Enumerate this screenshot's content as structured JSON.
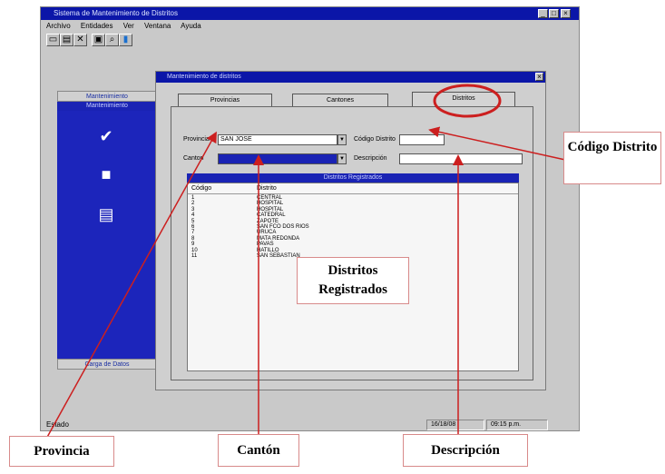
{
  "app": {
    "title": "Sistema de Mantenimiento de Distritos",
    "menu": [
      "Archivo",
      "Entidades",
      "Ver",
      "Ventana",
      "Ayuda"
    ],
    "toolbar_icons": [
      "new-doc-icon",
      "open-icon",
      "delete-icon",
      "save-icon",
      "find-icon",
      "exit-icon"
    ],
    "left_panel": {
      "header1": "Mantenimiento",
      "header2": "Mantenimiento",
      "footer": "Carga de Datos"
    },
    "status": {
      "label": "Estado",
      "date": "16/18/08",
      "time": "09:15 p.m."
    }
  },
  "inner": {
    "title": "Mantenimiento de distritos",
    "tabs": [
      "Provincias",
      "Cantones",
      "Distritos"
    ],
    "form": {
      "provincia_label": "Provincia",
      "provincia_value": "SAN JOSE",
      "canton_label": "Canton",
      "canton_value": "",
      "codigo_label": "Código Distrito",
      "codigo_value": "",
      "descripcion_label": "Descripción",
      "descripcion_value": ""
    },
    "list": {
      "header": "Distritos Registrados",
      "columns": [
        "Código",
        "Distrito"
      ],
      "rows": [
        [
          "1",
          "CENTRAL"
        ],
        [
          "2",
          "HOSPITAL"
        ],
        [
          "3",
          "HOSPITAL"
        ],
        [
          "4",
          "CATEDRAL"
        ],
        [
          "5",
          "ZAPOTE"
        ],
        [
          "6",
          "SAN FCO DOS RIOS"
        ],
        [
          "7",
          "URUCA"
        ],
        [
          "8",
          "MATA REDONDA"
        ],
        [
          "9",
          "PAVAS"
        ],
        [
          "10",
          "HATILLO"
        ],
        [
          "11",
          "SAN SEBASTIAN"
        ]
      ]
    }
  },
  "callouts": {
    "codigo_distrito": "Código Distrito",
    "distritos_registrados": "Distritos Registrados",
    "provincia": "Provincia",
    "canton": "Cantón",
    "descripcion": "Descripción"
  },
  "colors": {
    "title_blue": "#0b16a8",
    "panel_blue": "#1c25bb",
    "annotation_red": "#cc1f1f"
  }
}
